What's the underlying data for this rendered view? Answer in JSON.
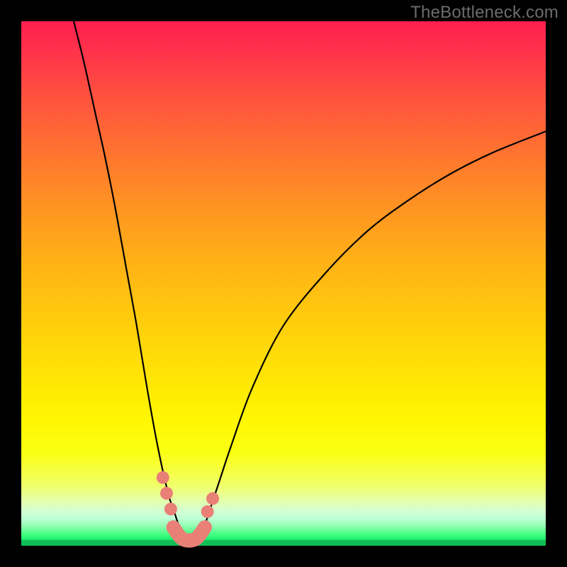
{
  "watermark": "TheBottleneck.com",
  "chart_data": {
    "type": "line",
    "title": "",
    "xlabel": "",
    "ylabel": "",
    "xlim": [
      0,
      100
    ],
    "ylim": [
      0,
      100
    ],
    "grid": false,
    "legend": false,
    "series": [
      {
        "name": "curve",
        "x": [
          10,
          12,
          14,
          16,
          18,
          20,
          22,
          24,
          26,
          28,
          29,
          30,
          31,
          32,
          33,
          34,
          35,
          36,
          38,
          40,
          44,
          50,
          58,
          66,
          74,
          82,
          90,
          100
        ],
        "y": [
          100,
          92,
          83,
          74,
          64,
          53,
          42,
          30,
          19,
          10,
          7,
          4,
          2,
          1,
          1,
          2,
          4,
          7,
          13,
          19,
          30,
          42,
          52,
          60,
          66,
          71,
          75,
          79
        ]
      }
    ],
    "markers": [
      {
        "x": 27.0,
        "y": 13.0
      },
      {
        "x": 27.7,
        "y": 10.0
      },
      {
        "x": 28.5,
        "y": 7.0
      },
      {
        "x": 35.5,
        "y": 6.5
      },
      {
        "x": 36.5,
        "y": 9.0
      }
    ],
    "valley_segment": {
      "x": [
        29.0,
        30.5,
        32.0,
        33.5,
        35.0
      ],
      "y": [
        3.5,
        1.5,
        1.0,
        1.5,
        3.5
      ]
    },
    "background_gradient": {
      "top_color": "#ff1f4f",
      "mid_color": "#ffe106",
      "bottom_color": "#0fbf56"
    }
  }
}
